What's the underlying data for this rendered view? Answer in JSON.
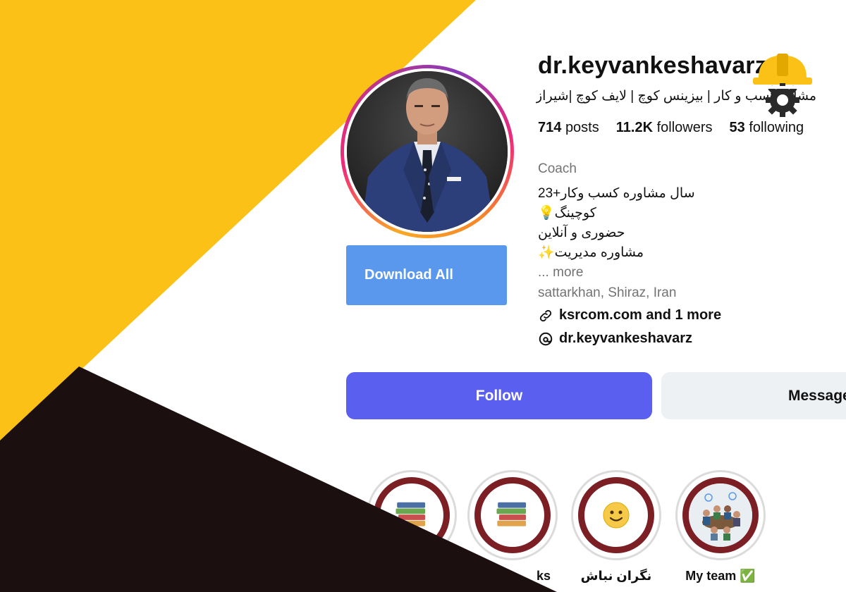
{
  "profile": {
    "username": "dr.keyvankeshavarz",
    "full_name": "مشاور کسب و کار | بیزینس کوچ | لایف کوچ |شیراز",
    "stats": {
      "posts_count": "714",
      "posts_label": "posts",
      "followers_count": "11.2K",
      "followers_label": "followers",
      "following_count": "53",
      "following_label": "following"
    },
    "category": "Coach",
    "bio_lines": [
      "23+سال مشاوره کسب وکار",
      "💡کوچینگ",
      "حضوری و آنلاین",
      "✨مشاوره مدیریت"
    ],
    "more_label": "... more",
    "location": "sattarkhan, Shiraz, Iran",
    "link_text": "ksrcom.com and 1 more",
    "link_icon": "link-icon",
    "threads_handle": "dr.keyvankeshavarz",
    "threads_icon": "threads-icon"
  },
  "actions": {
    "download_all": "Download All",
    "follow": "Follow",
    "message": "Message"
  },
  "highlights": [
    {
      "label": "",
      "icon": "books-icon"
    },
    {
      "label": "ks",
      "icon": "books-icon"
    },
    {
      "label": "نگران نباش",
      "icon": "smiley-icon"
    },
    {
      "label": "My team ✅",
      "icon": "team-icon"
    }
  ],
  "colors": {
    "yellow_background": "#fbc117",
    "dark_background": "#1b0f0f",
    "follow_button": "#5b5ff0",
    "download_button": "#5a98ee",
    "highlight_ring": "#7b1f24"
  }
}
